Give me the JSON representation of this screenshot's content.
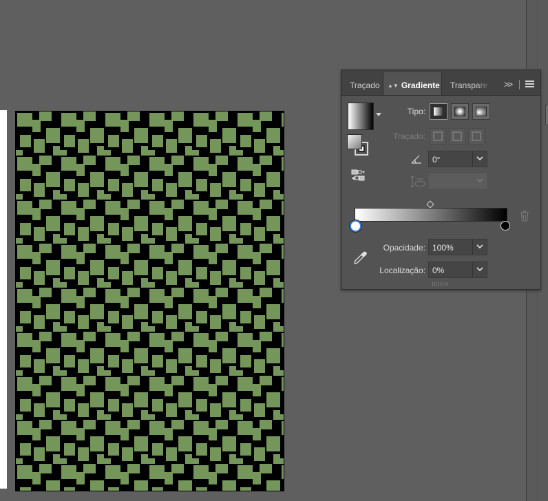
{
  "panel": {
    "tabs": [
      {
        "label": "Traçado"
      },
      {
        "label": "Gradiente",
        "active": true
      },
      {
        "label": "Transparência",
        "display": "Transpare"
      }
    ],
    "more_icon": "double-chevron-right-icon",
    "menu_icon": "hamburger-menu-icon"
  },
  "gradient": {
    "tipo_label": "Tipo:",
    "tracado_label": "Traçado:",
    "angle_value": "0°",
    "aspect_value": "",
    "opacidade_label": "Opacidade:",
    "opacidade_value": "100%",
    "localizacao_label": "Localização:",
    "localizacao_value": "0%",
    "start_color": "#ffffff",
    "end_color": "#000000",
    "selected_stop": 0
  },
  "colors": {
    "pattern_green": "#74965b",
    "pattern_black": "#000000",
    "stop_selection": "#3d7de0"
  }
}
